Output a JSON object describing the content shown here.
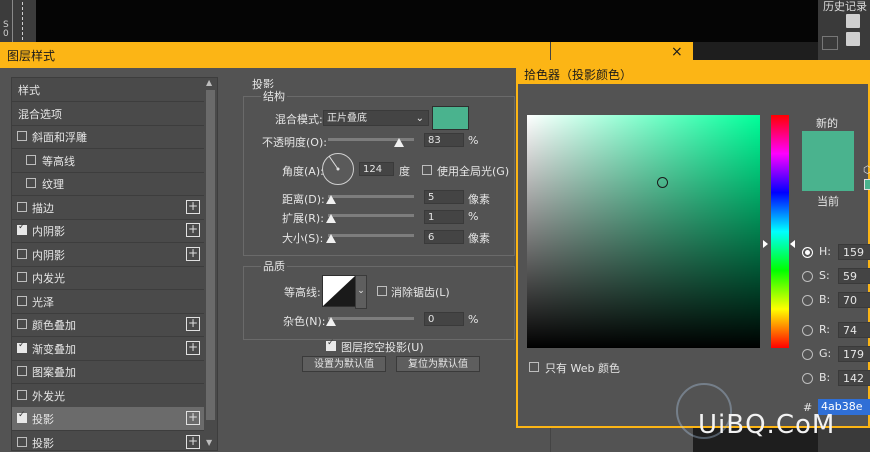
{
  "top": {
    "history_label": "历史记录",
    "tool_chars": [
      "S",
      "0"
    ]
  },
  "dialog": {
    "title": "图层样式",
    "close": "×"
  },
  "style_list": {
    "items": [
      {
        "label": "样式",
        "checkbox": false,
        "checked": false,
        "plus": false,
        "selected": false,
        "indent": 0
      },
      {
        "label": "混合选项",
        "checkbox": false,
        "checked": false,
        "plus": false,
        "selected": false,
        "indent": 0
      },
      {
        "label": "斜面和浮雕",
        "checkbox": true,
        "checked": false,
        "plus": false,
        "selected": false,
        "indent": 0
      },
      {
        "label": "等高线",
        "checkbox": true,
        "checked": false,
        "plus": false,
        "selected": false,
        "indent": 1
      },
      {
        "label": "纹理",
        "checkbox": true,
        "checked": false,
        "plus": false,
        "selected": false,
        "indent": 1
      },
      {
        "label": "描边",
        "checkbox": true,
        "checked": false,
        "plus": true,
        "selected": false,
        "indent": 0
      },
      {
        "label": "内阴影",
        "checkbox": true,
        "checked": true,
        "plus": true,
        "selected": false,
        "indent": 0
      },
      {
        "label": "内阴影",
        "checkbox": true,
        "checked": false,
        "plus": true,
        "selected": false,
        "indent": 0
      },
      {
        "label": "内发光",
        "checkbox": true,
        "checked": false,
        "plus": false,
        "selected": false,
        "indent": 0
      },
      {
        "label": "光泽",
        "checkbox": true,
        "checked": false,
        "plus": false,
        "selected": false,
        "indent": 0
      },
      {
        "label": "颜色叠加",
        "checkbox": true,
        "checked": false,
        "plus": true,
        "selected": false,
        "indent": 0
      },
      {
        "label": "渐变叠加",
        "checkbox": true,
        "checked": true,
        "plus": true,
        "selected": false,
        "indent": 0
      },
      {
        "label": "图案叠加",
        "checkbox": true,
        "checked": false,
        "plus": false,
        "selected": false,
        "indent": 0
      },
      {
        "label": "外发光",
        "checkbox": true,
        "checked": false,
        "plus": false,
        "selected": false,
        "indent": 0
      },
      {
        "label": "投影",
        "checkbox": true,
        "checked": true,
        "plus": true,
        "selected": true,
        "indent": 0
      },
      {
        "label": "投影",
        "checkbox": true,
        "checked": false,
        "plus": true,
        "selected": false,
        "indent": 0
      }
    ]
  },
  "shadow": {
    "section_title": "投影",
    "structure_title": "结构",
    "blend_mode_label": "混合模式:",
    "blend_mode_value": "正片叠底",
    "swatch_color": "#4ab38e",
    "opacity_label": "不透明度(O):",
    "opacity_value": "83",
    "opacity_unit": "%",
    "opacity_level": 0.83,
    "angle_label": "角度(A):",
    "angle_value": "124",
    "angle_unit": "度",
    "global_light_label": "使用全局光(G)",
    "global_light_checked": false,
    "distance_label": "距离(D):",
    "distance_value": "5",
    "distance_unit": "像素",
    "spread_label": "扩展(R):",
    "spread_value": "1",
    "spread_unit": "%",
    "size_label": "大小(S):",
    "size_value": "6",
    "size_unit": "像素",
    "quality_title": "品质",
    "contour_label": "等高线:",
    "antialias_label": "消除锯齿(L)",
    "antialias_checked": false,
    "noise_label": "杂色(N):",
    "noise_value": "0",
    "noise_unit": "%",
    "knockout_label": "图层挖空投影(U)",
    "knockout_checked": true,
    "set_default_button": "设置为默认值",
    "reset_default_button": "复位为默认值"
  },
  "picker": {
    "title": "拾色器（投影颜色）",
    "new_label": "新的",
    "current_label": "当前",
    "new_color": "#4ab38e",
    "current_color": "#4ab38e",
    "web_only_label": "只有 Web 颜色",
    "fields": [
      {
        "label": "H:",
        "value": "159",
        "unit": "",
        "checked": true
      },
      {
        "label": "S:",
        "value": "59",
        "unit": "",
        "checked": false
      },
      {
        "label": "B:",
        "value": "70",
        "unit": "",
        "checked": false
      },
      {
        "label": "R:",
        "value": "74",
        "unit": "",
        "checked": false
      },
      {
        "label": "G:",
        "value": "179",
        "unit": "",
        "checked": false
      },
      {
        "label": "B:",
        "value": "142",
        "unit": "",
        "checked": false
      }
    ],
    "hex_label": "#",
    "hex_value": "4ab38e"
  },
  "watermark": "UiBQ.CoM"
}
